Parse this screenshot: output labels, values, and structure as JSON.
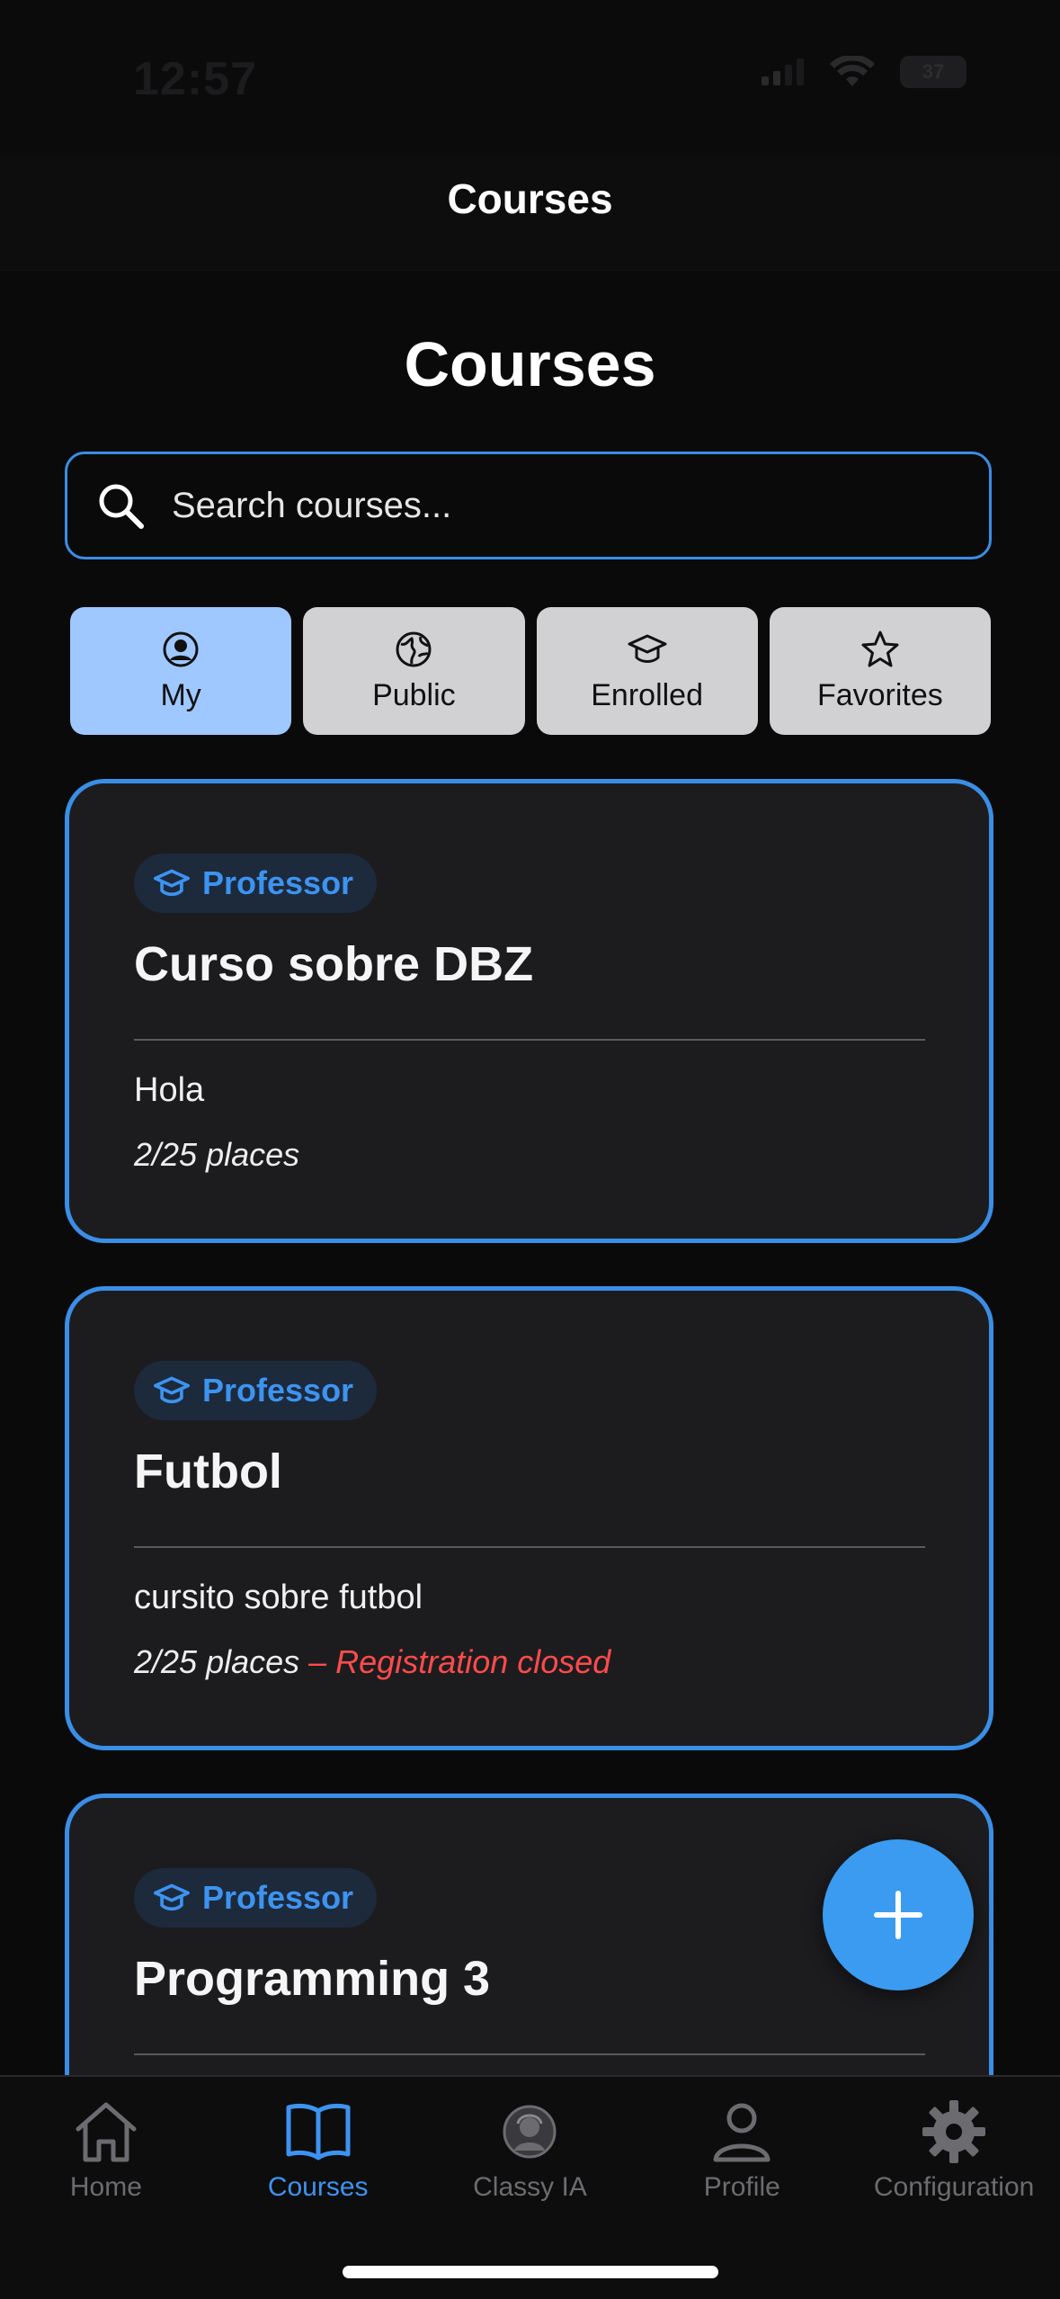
{
  "status_bar": {
    "time": "12:57",
    "battery": "37"
  },
  "header": {
    "title": "Courses"
  },
  "page": {
    "title": "Courses"
  },
  "search": {
    "placeholder": "Search courses..."
  },
  "filter_tabs": [
    {
      "label": "My",
      "icon": "user-circle-icon",
      "active": true
    },
    {
      "label": "Public",
      "icon": "globe-icon",
      "active": false
    },
    {
      "label": "Enrolled",
      "icon": "graduation-cap-icon",
      "active": false
    },
    {
      "label": "Favorites",
      "icon": "star-icon",
      "active": false
    }
  ],
  "courses": [
    {
      "role": "Professor",
      "title": "Curso sobre DBZ",
      "description": "Hola",
      "places": "2/25 places",
      "status": ""
    },
    {
      "role": "Professor",
      "title": "Futbol",
      "description": "cursito sobre futbol",
      "places": "2/25 places",
      "status": " – Registration closed"
    },
    {
      "role": "Professor",
      "title": "Programming 3",
      "description": "",
      "places": "",
      "status": ""
    }
  ],
  "fab": {
    "icon": "plus-icon"
  },
  "tab_bar": [
    {
      "label": "Home",
      "icon": "home-icon",
      "active": false
    },
    {
      "label": "Courses",
      "icon": "book-open-icon",
      "active": true
    },
    {
      "label": "Classy IA",
      "icon": "assistant-avatar-icon",
      "active": false
    },
    {
      "label": "Profile",
      "icon": "person-icon",
      "active": false
    },
    {
      "label": "Configuration",
      "icon": "gear-icon",
      "active": false
    }
  ],
  "colors": {
    "accent": "#3a8ee6",
    "active_tab": "#9ec8ff",
    "closed": "#ff4b4b",
    "card": "#1c1c1f"
  }
}
